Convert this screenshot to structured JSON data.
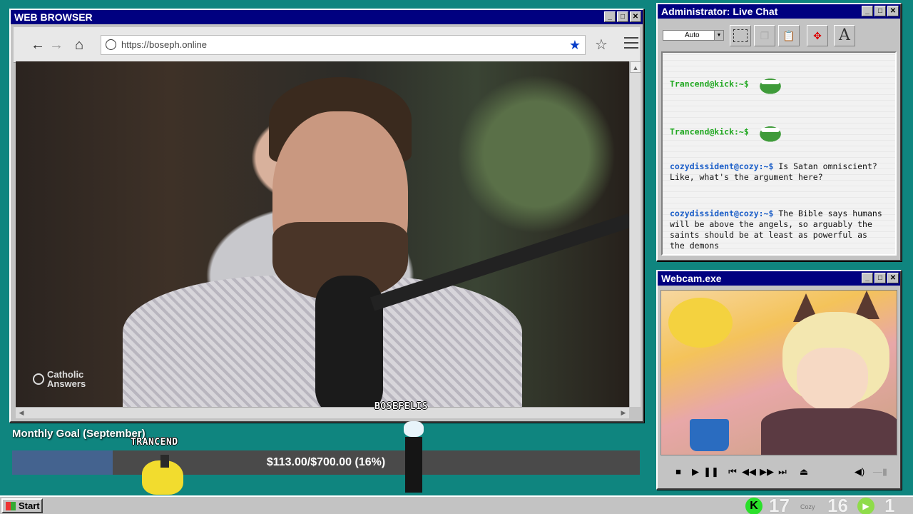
{
  "browser": {
    "title": "WEB BROWSER",
    "url": "https://boseph.online",
    "video_logo": "Catholic\nAnswers"
  },
  "chat": {
    "title": "Administrator: Live Chat",
    "zoom_select": "Auto",
    "messages": [
      {
        "user": "Trancend@kick:~$",
        "text": "",
        "emote": true
      },
      {
        "user": "Trancend@kick:~$",
        "text": "",
        "emote": true
      },
      {
        "user": "cozydissident@cozy:~$",
        "text": "Is Satan omniscient? Like, what's the argument here?"
      },
      {
        "user": "cozydissident@cozy:~$",
        "text": "The Bible says humans will be above the angels, so arguably the saints should be at least as powerful as the demons"
      }
    ]
  },
  "webcam": {
    "title": "Webcam.exe"
  },
  "goal": {
    "title": "Monthly Goal (September)",
    "text": "$113.00/$700.00 (16%)",
    "fraction": 0.16
  },
  "characters": {
    "label1": "BOSEFELIS",
    "label2": "TRANCEND"
  },
  "taskbar": {
    "start": "Start",
    "count1": "17",
    "small_label": "Cozy",
    "count2": "16",
    "count3": "1"
  }
}
